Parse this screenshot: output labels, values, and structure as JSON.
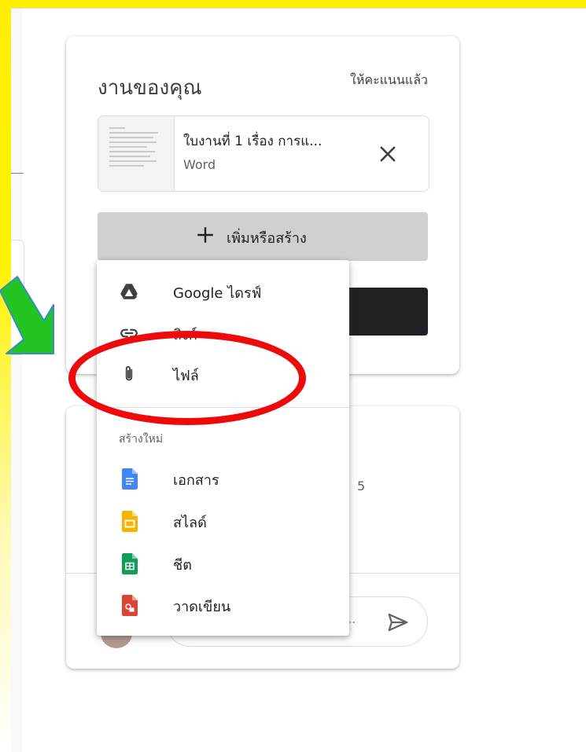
{
  "work_card": {
    "title": "งานของคุณ",
    "status": "ให้คะแนนแล้ว",
    "attachment": {
      "name": "ใบงานที่ 1 เรื่อง การแ...",
      "type": "Word"
    },
    "add_button_label": "เพิ่มหรือสร้าง"
  },
  "menu": {
    "items": [
      {
        "label": "Google ไดรฟ์",
        "icon": "google-drive-icon"
      },
      {
        "label": "ลิงก์",
        "icon": "link-icon"
      },
      {
        "label": "ไฟล์",
        "icon": "paperclip-icon"
      }
    ],
    "create_section_label": "สร้างใหม่",
    "create_items": [
      {
        "label": "เอกสาร",
        "icon": "google-docs-icon",
        "color": "#4285f4"
      },
      {
        "label": "สไลด์",
        "icon": "google-slides-icon",
        "color": "#f4b400"
      },
      {
        "label": "ชีต",
        "icon": "google-sheets-icon",
        "color": "#0f9d58"
      },
      {
        "label": "วาดเขียน",
        "icon": "google-drawings-icon",
        "color": "#db4437"
      }
    ]
  },
  "comments_card": {
    "count": "5",
    "input_placeholder": "..."
  },
  "annotations": {
    "highlight_color": "#ee0a0a",
    "arrow_color": "#22c522"
  },
  "theme": {
    "accent": "#1a73e8",
    "frame": "#ffee00"
  }
}
